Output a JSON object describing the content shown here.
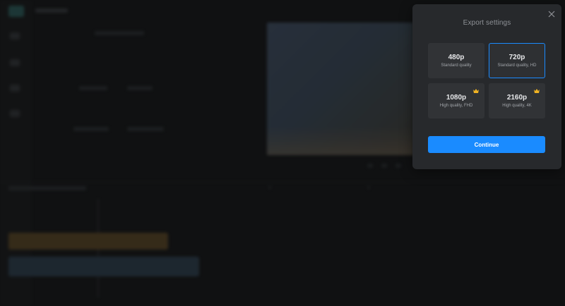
{
  "modal": {
    "title": "Export settings",
    "close_icon": "close-icon",
    "options": [
      {
        "label": "480p",
        "description": "Standard quality",
        "selected": false,
        "premium": false
      },
      {
        "label": "720p",
        "description": "Standard quality, HD",
        "selected": true,
        "premium": false
      },
      {
        "label": "1080p",
        "description": "High quality, FHD",
        "selected": false,
        "premium": true
      },
      {
        "label": "2160p",
        "description": "High quality, 4K",
        "selected": false,
        "premium": true
      }
    ],
    "premium_icon": "crown-icon",
    "continue_label": "Continue"
  },
  "colors": {
    "accent": "#1a8bff",
    "premium": "#f0b323",
    "modal_bg": "#27292c",
    "page_bg": "#101112"
  }
}
